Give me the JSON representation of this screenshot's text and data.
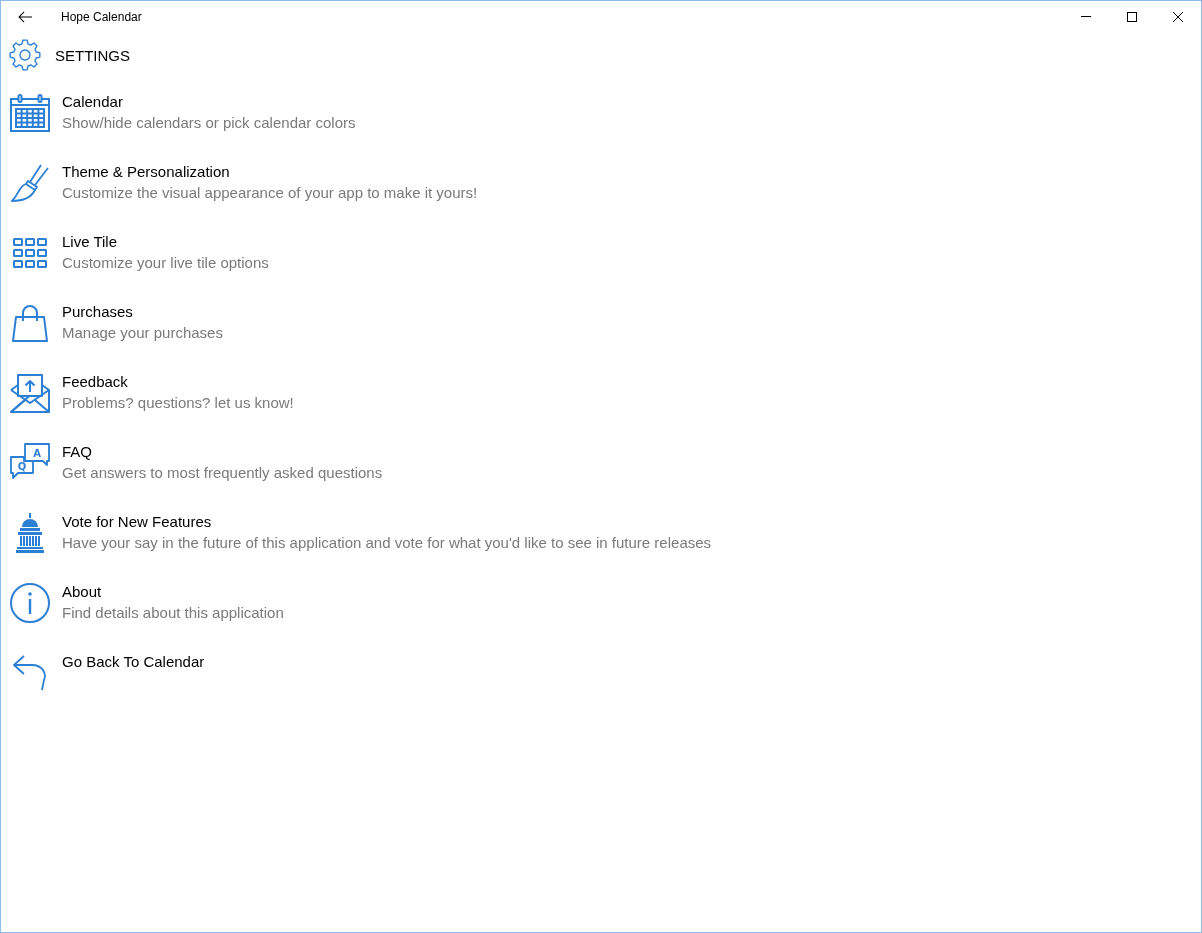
{
  "window": {
    "title": "Hope Calendar"
  },
  "header": {
    "title": "SETTINGS"
  },
  "items": [
    {
      "title": "Calendar",
      "subtitle": "Show/hide calendars or pick calendar colors"
    },
    {
      "title": "Theme & Personalization",
      "subtitle": "Customize the visual appearance of your app to make it yours!"
    },
    {
      "title": "Live Tile",
      "subtitle": "Customize your live tile options"
    },
    {
      "title": "Purchases",
      "subtitle": "Manage your purchases"
    },
    {
      "title": "Feedback",
      "subtitle": "Problems? questions? let us know!"
    },
    {
      "title": "FAQ",
      "subtitle": "Get answers to most frequently asked questions",
      "icon_letters": [
        "Q",
        "A"
      ]
    },
    {
      "title": "Vote for New Features",
      "subtitle": "Have your say in the future of this application and vote for what you'd like to see in future releases"
    },
    {
      "title": "About",
      "subtitle": "Find details about this application"
    },
    {
      "title": "Go Back To Calendar"
    }
  ]
}
